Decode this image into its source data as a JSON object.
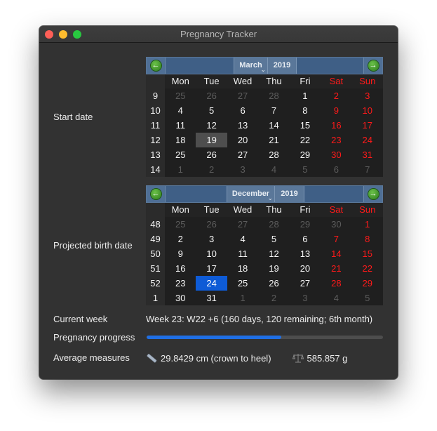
{
  "window": {
    "title": "Pregnancy Tracker"
  },
  "labels": {
    "start_date": "Start date",
    "projected_birth_date": "Projected birth date",
    "current_week": "Current week",
    "pregnancy_progress": "Pregnancy progress",
    "average_measures": "Average measures"
  },
  "weekdays": [
    "Mon",
    "Tue",
    "Wed",
    "Thu",
    "Fri",
    "Sat",
    "Sun"
  ],
  "start_calendar": {
    "month": "March",
    "year": "2019",
    "weeks": [
      "9",
      "10",
      "11",
      "12",
      "13",
      "14"
    ],
    "days": [
      [
        {
          "d": "25",
          "o": 1
        },
        {
          "d": "26",
          "o": 1
        },
        {
          "d": "27",
          "o": 1
        },
        {
          "d": "28",
          "o": 1
        },
        {
          "d": "1"
        },
        {
          "d": "2"
        },
        {
          "d": "3"
        }
      ],
      [
        {
          "d": "4"
        },
        {
          "d": "5"
        },
        {
          "d": "6"
        },
        {
          "d": "7"
        },
        {
          "d": "8"
        },
        {
          "d": "9"
        },
        {
          "d": "10"
        }
      ],
      [
        {
          "d": "11"
        },
        {
          "d": "12"
        },
        {
          "d": "13"
        },
        {
          "d": "14"
        },
        {
          "d": "15"
        },
        {
          "d": "16"
        },
        {
          "d": "17"
        }
      ],
      [
        {
          "d": "18"
        },
        {
          "d": "19",
          "s": "grey"
        },
        {
          "d": "20"
        },
        {
          "d": "21"
        },
        {
          "d": "22"
        },
        {
          "d": "23"
        },
        {
          "d": "24"
        }
      ],
      [
        {
          "d": "25"
        },
        {
          "d": "26"
        },
        {
          "d": "27"
        },
        {
          "d": "28"
        },
        {
          "d": "29"
        },
        {
          "d": "30"
        },
        {
          "d": "31"
        }
      ],
      [
        {
          "d": "1",
          "o": 1
        },
        {
          "d": "2",
          "o": 1
        },
        {
          "d": "3",
          "o": 1
        },
        {
          "d": "4",
          "o": 1
        },
        {
          "d": "5",
          "o": 1
        },
        {
          "d": "6",
          "o": 1
        },
        {
          "d": "7",
          "o": 1
        }
      ]
    ],
    "selected_date": "2019-03-19"
  },
  "birth_calendar": {
    "month": "December",
    "year": "2019",
    "weeks": [
      "48",
      "49",
      "50",
      "51",
      "52",
      "1"
    ],
    "days": [
      [
        {
          "d": "25",
          "o": 1
        },
        {
          "d": "26",
          "o": 1
        },
        {
          "d": "27",
          "o": 1
        },
        {
          "d": "28",
          "o": 1
        },
        {
          "d": "29",
          "o": 1
        },
        {
          "d": "30",
          "o": 1
        },
        {
          "d": "1"
        }
      ],
      [
        {
          "d": "2"
        },
        {
          "d": "3"
        },
        {
          "d": "4"
        },
        {
          "d": "5"
        },
        {
          "d": "6"
        },
        {
          "d": "7"
        },
        {
          "d": "8"
        }
      ],
      [
        {
          "d": "9"
        },
        {
          "d": "10"
        },
        {
          "d": "11"
        },
        {
          "d": "12"
        },
        {
          "d": "13"
        },
        {
          "d": "14"
        },
        {
          "d": "15"
        }
      ],
      [
        {
          "d": "16"
        },
        {
          "d": "17"
        },
        {
          "d": "18"
        },
        {
          "d": "19"
        },
        {
          "d": "20"
        },
        {
          "d": "21"
        },
        {
          "d": "22"
        }
      ],
      [
        {
          "d": "23"
        },
        {
          "d": "24",
          "s": "blue"
        },
        {
          "d": "25"
        },
        {
          "d": "26"
        },
        {
          "d": "27"
        },
        {
          "d": "28"
        },
        {
          "d": "29"
        }
      ],
      [
        {
          "d": "30"
        },
        {
          "d": "31"
        },
        {
          "d": "1",
          "o": 1
        },
        {
          "d": "2",
          "o": 1
        },
        {
          "d": "3",
          "o": 1
        },
        {
          "d": "4",
          "o": 1
        },
        {
          "d": "5",
          "o": 1
        }
      ]
    ],
    "selected_date": "2019-12-24"
  },
  "current_week": "Week 23: W22 +6 (160 days, 120 remaining; 6th month)",
  "progress": {
    "fraction": 0.571
  },
  "measures": {
    "length_icon": "ruler-icon",
    "length": "29.8429 cm (crown to heel)",
    "weight_icon": "scale-icon",
    "weight": "585.857 g"
  },
  "colors": {
    "weekend": "#ff1a1a",
    "accent": "#1f6fe5",
    "selected_start": "#4e4e4e",
    "selected_birth": "#0e5bd6",
    "calendar_header": "#3f5f86"
  }
}
